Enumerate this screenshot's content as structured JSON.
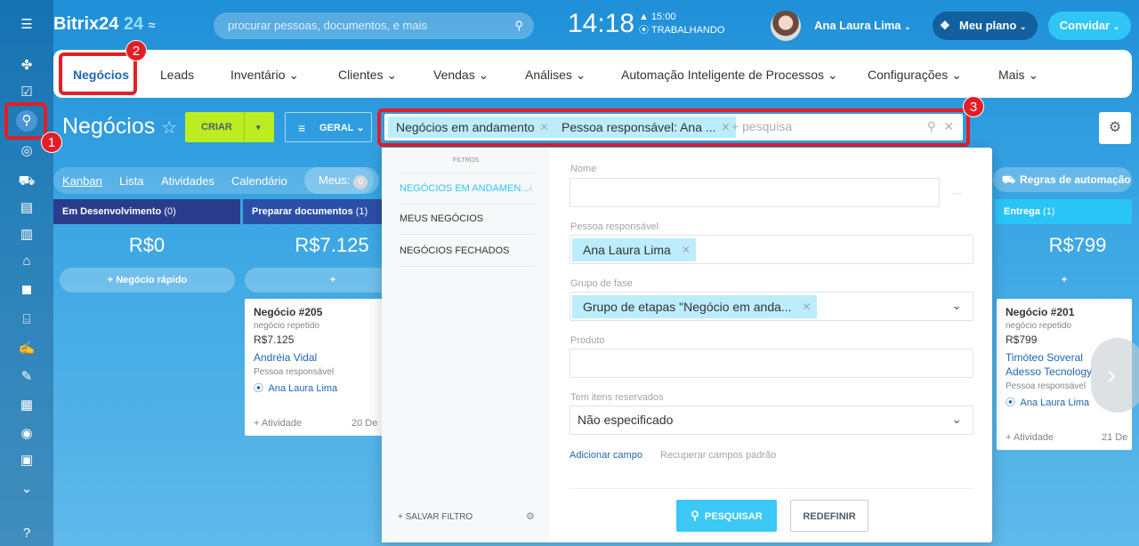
{
  "logo": {
    "name": "Bitrix24",
    "num": "24",
    "sync": "≈"
  },
  "search": {
    "placeholder": "procurar pessoas, documentos, e mais"
  },
  "clock": {
    "time": "14:18",
    "worktime": "▲ 15:00",
    "status": "⦿ TRABALHANDO"
  },
  "user": {
    "name": "Ana Laura Lima"
  },
  "plan": {
    "label": "Meu plano"
  },
  "invite": {
    "label": "Convidar"
  },
  "nav": {
    "items": [
      {
        "label": "Negócios"
      },
      {
        "label": "Leads"
      },
      {
        "label": "Inventário"
      },
      {
        "label": "Clientes"
      },
      {
        "label": "Vendas"
      },
      {
        "label": "Análises"
      },
      {
        "label": "Automação Inteligente de Processos"
      },
      {
        "label": "Configurações"
      },
      {
        "label": "Mais"
      }
    ]
  },
  "page": {
    "title": "Negócios",
    "star": "☆"
  },
  "toolbar": {
    "criar": "CRIAR",
    "geral": "GERAL"
  },
  "filter_bar": {
    "chips": [
      "Negócios em andamento",
      "Pessoa responsável: Ana ..."
    ],
    "placeholder": "+ pesquisa"
  },
  "views": {
    "items": [
      "Kanban",
      "Lista",
      "Atividades",
      "Calendário"
    ],
    "meus": "Meus:",
    "meus_count": "0"
  },
  "automation": {
    "label": "Regras de automação"
  },
  "callouts": [
    "1",
    "2",
    "3"
  ],
  "columns": [
    {
      "title": "Em Desenvolvimento",
      "count": "(0)",
      "sum": "R$0",
      "quick": "+ Negócio rápido",
      "color": "#2b3c8c"
    },
    {
      "title": "Preparar documentos",
      "count": "(1)",
      "sum": "R$7.125",
      "quick": "+",
      "color": "#2b4fa6"
    },
    {
      "title": "Entrega",
      "count": "(1)",
      "sum": "R$799",
      "quick": "+",
      "color": "#29c5f6"
    }
  ],
  "cards": [
    {
      "title": "Negócio #205",
      "sub": "negócio repetido",
      "amount": "R$7.125",
      "contact": "Andréia Vidal",
      "company": "",
      "resp_label": "Pessoa responsável",
      "resp": "Ana Laura Lima",
      "activity": "+ Atividade",
      "date": "20 De"
    },
    {
      "title": "Negócio #201",
      "sub": "negócio repetido",
      "amount": "R$799",
      "contact": "Timóteo Soveral",
      "company": "Adesso Tecnology",
      "resp_label": "Pessoa responsável",
      "resp": "Ana Laura Lima",
      "activity": "+ Atividade",
      "date": "21 De"
    }
  ],
  "popup": {
    "filters_header": "FILTROS",
    "presets": [
      "NEGÓCIOS EM ANDAMEN...",
      "MEUS NEGÓCIOS",
      "NEGÓCIOS FECHADOS"
    ],
    "save_filter": "+ SALVAR FILTRO",
    "fields": [
      {
        "label": "Nome",
        "value": ""
      },
      {
        "label": "Pessoa responsável",
        "value": "Ana Laura Lima"
      },
      {
        "label": "Grupo de fase",
        "value": "Grupo de etapas \"Negócio em anda..."
      },
      {
        "label": "Produto",
        "value": ""
      },
      {
        "label": "Tem itens reservados",
        "value": "Não especificado"
      }
    ],
    "add_field": "Adicionar campo",
    "restore": "Recuperar campos padrão",
    "search_btn": "PESQUISAR",
    "reset_btn": "REDEFINIR"
  },
  "colors": {
    "accent": "#2fc6f6",
    "highlight": "#e21e26",
    "criar": "#bbed21"
  }
}
